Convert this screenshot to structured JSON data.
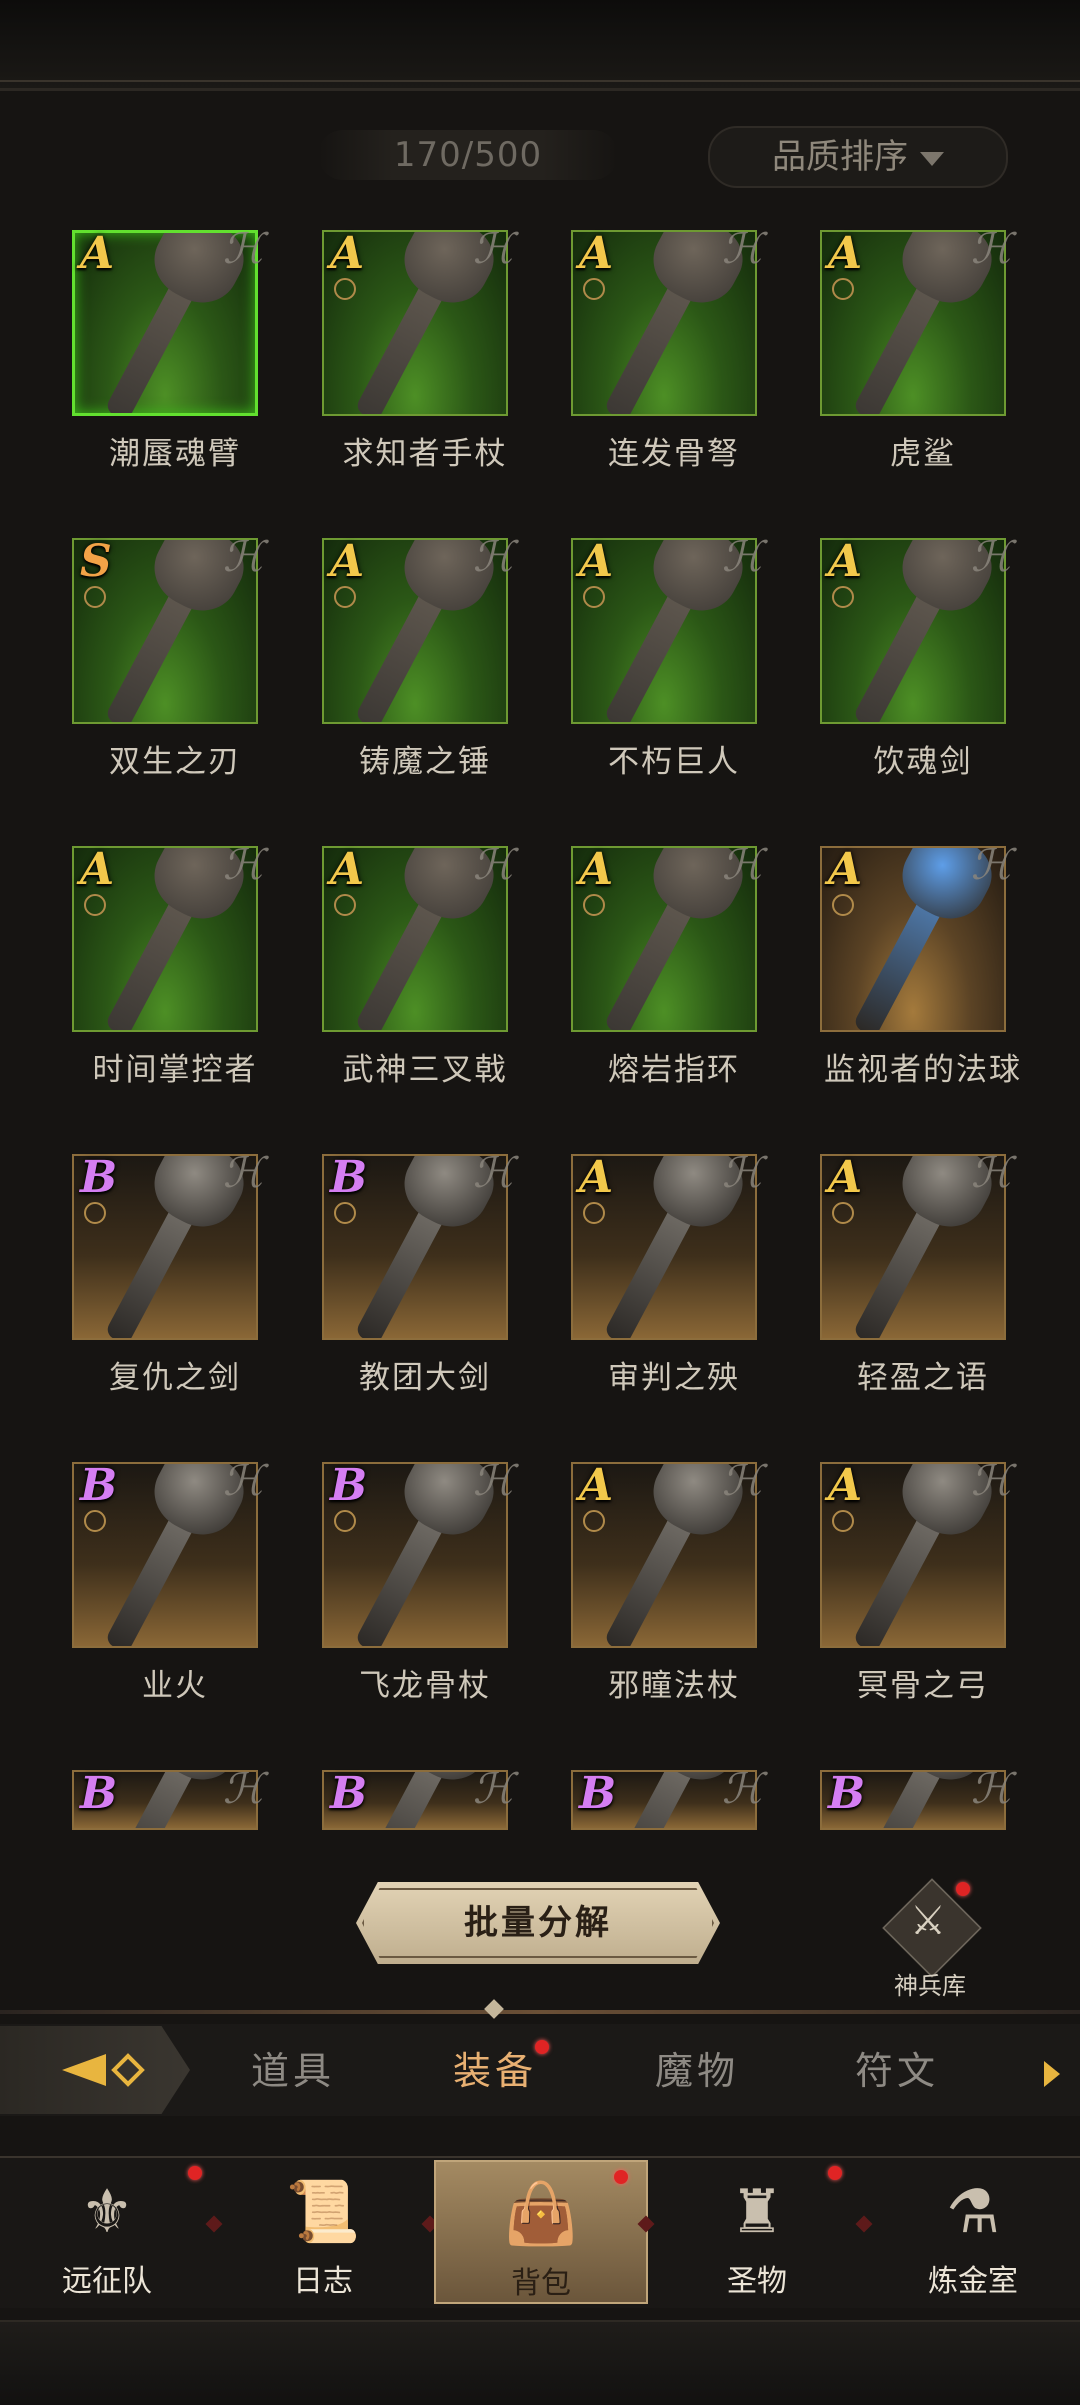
{
  "header": {
    "count": "170/500",
    "sort_label": "品质排序"
  },
  "items": [
    {
      "name": "潮蜃魂臂",
      "grade": "A",
      "bg": "green",
      "selected": true
    },
    {
      "name": "求知者手杖",
      "grade": "A",
      "bg": "green"
    },
    {
      "name": "连发骨弩",
      "grade": "A",
      "bg": "green"
    },
    {
      "name": "虎鲨",
      "grade": "A",
      "bg": "green"
    },
    {
      "name": "双生之刃",
      "grade": "S",
      "bg": "green"
    },
    {
      "name": "铸魔之锤",
      "grade": "A",
      "bg": "green"
    },
    {
      "name": "不朽巨人",
      "grade": "A",
      "bg": "green"
    },
    {
      "name": "饮魂剑",
      "grade": "A",
      "bg": "green"
    },
    {
      "name": "时间掌控者",
      "grade": "A",
      "bg": "green"
    },
    {
      "name": "武神三叉戟",
      "grade": "A",
      "bg": "green"
    },
    {
      "name": "熔岩指环",
      "grade": "A",
      "bg": "green"
    },
    {
      "name": "监视者的法球",
      "grade": "A",
      "bg": "blue"
    },
    {
      "name": "复仇之剑",
      "grade": "B",
      "bg": "gold"
    },
    {
      "name": "教团大剑",
      "grade": "B",
      "bg": "gold"
    },
    {
      "name": "审判之殃",
      "grade": "A",
      "bg": "gold"
    },
    {
      "name": "轻盈之语",
      "grade": "A",
      "bg": "gold"
    },
    {
      "name": "业火",
      "grade": "B",
      "bg": "gold"
    },
    {
      "name": "飞龙骨杖",
      "grade": "B",
      "bg": "gold"
    },
    {
      "name": "邪瞳法杖",
      "grade": "A",
      "bg": "gold"
    },
    {
      "name": "冥骨之弓",
      "grade": "A",
      "bg": "gold"
    },
    {
      "name": "",
      "grade": "B",
      "bg": "gold",
      "partial": true
    },
    {
      "name": "",
      "grade": "B",
      "bg": "gold",
      "partial": true
    },
    {
      "name": "",
      "grade": "B",
      "bg": "gold",
      "partial": true
    },
    {
      "name": "",
      "grade": "B",
      "bg": "gold",
      "partial": true
    }
  ],
  "actions": {
    "decompose_label": "批量分解",
    "armory_label": "神兵库"
  },
  "tabs": [
    {
      "label": "道具",
      "active": false
    },
    {
      "label": "装备",
      "active": true,
      "badge": true
    },
    {
      "label": "魔物",
      "active": false
    },
    {
      "label": "符文",
      "active": false
    }
  ],
  "nav": [
    {
      "label": "远征队",
      "icon": "helmet-icon",
      "badge": true
    },
    {
      "label": "日志",
      "icon": "scroll-icon",
      "badge": false
    },
    {
      "label": "背包",
      "icon": "bag-icon",
      "badge": true,
      "active": true
    },
    {
      "label": "圣物",
      "icon": "relic-icon",
      "badge": true
    },
    {
      "label": "炼金室",
      "icon": "alchemy-icon",
      "badge": false
    }
  ],
  "colors": {
    "grade_A": "#f2c84b",
    "grade_S": "#f3a347",
    "grade_B": "#d57ef2",
    "active_tab": "#e8b072",
    "badge": "#e02424"
  }
}
